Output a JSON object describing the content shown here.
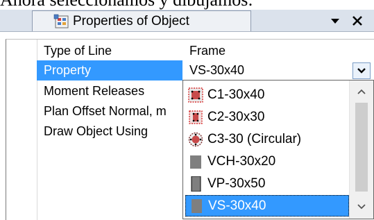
{
  "caption": "Ahora seleccionamos y dibujamos:",
  "panel": {
    "title": "Properties of Object",
    "title_icon": "properties-icon",
    "menu_icon": "dropdown-menu-icon",
    "close_icon": "close-icon"
  },
  "properties": [
    {
      "name": "Type of Line",
      "value": "Frame"
    },
    {
      "name": "Property",
      "value": "VS-30x40"
    },
    {
      "name": "Moment Releases",
      "value": ""
    },
    {
      "name": "Plan Offset Normal, m",
      "value": ""
    },
    {
      "name": "Draw Object Using",
      "value": ""
    }
  ],
  "dropdown": {
    "options": [
      {
        "label": "C1-30x40",
        "icon": "rect-section-icon"
      },
      {
        "label": "C2-30x30",
        "icon": "rect-section-icon"
      },
      {
        "label": "C3-30 (Circular)",
        "icon": "circular-section-icon"
      },
      {
        "label": "VCH-30x20",
        "icon": "beam-section-icon"
      },
      {
        "label": "VP-30x50",
        "icon": "beam-section-icon"
      },
      {
        "label": "VS-30x40",
        "icon": "beam-section-icon"
      }
    ],
    "selected": "VS-30x40",
    "scroll_up_icon": "chevron-up-icon",
    "scroll_down_icon": "chevron-down-icon"
  },
  "colors": {
    "selection": "#3399ff",
    "section_red": "#d83030",
    "section_gray": "#7f7f7f"
  }
}
